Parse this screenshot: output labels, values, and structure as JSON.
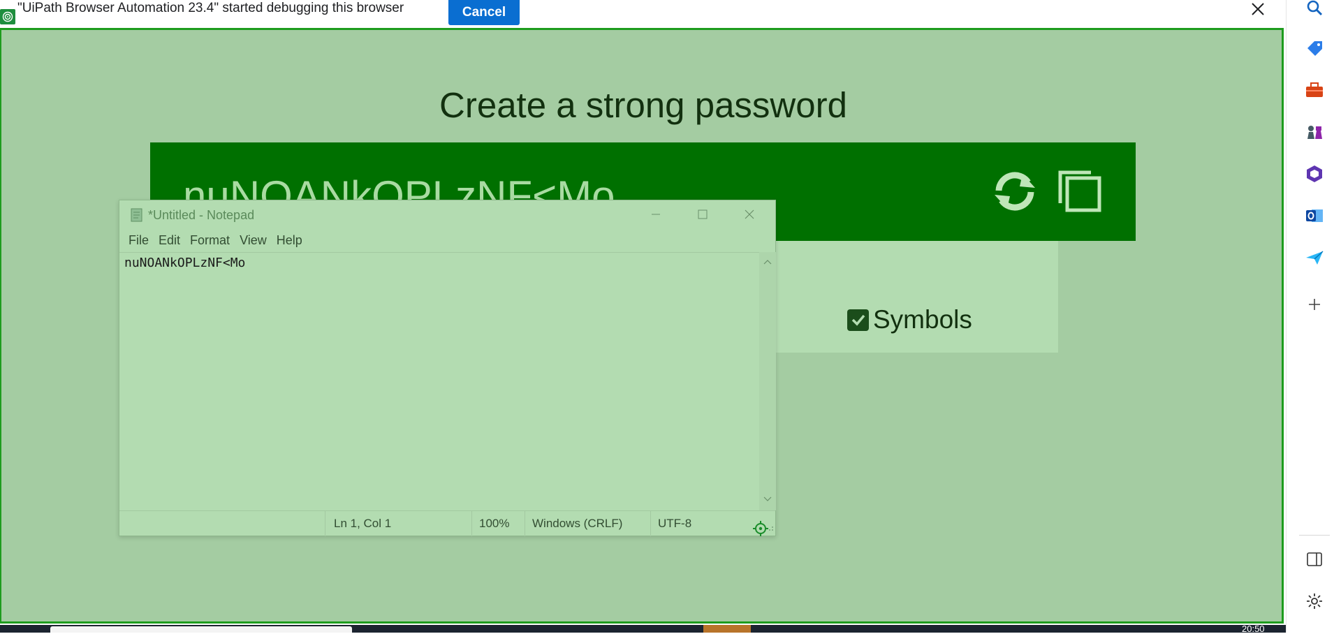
{
  "infobar": {
    "message": "\"UiPath Browser Automation 23.4\" started debugging this browser",
    "cancel_label": "Cancel"
  },
  "page": {
    "heading": "Create a strong password",
    "password": "nuNOANkOPLzNF<Mo",
    "options": {
      "symbols_label": "Symbols",
      "symbols_checked": true
    }
  },
  "notepad": {
    "title": "*Untitled - Notepad",
    "menu": [
      "File",
      "Edit",
      "Format",
      "View",
      "Help"
    ],
    "content": "nuNOANkOPLzNF<Mo",
    "status": {
      "position": "Ln 1, Col 1",
      "zoom": "100%",
      "line_endings": "Windows (CRLF)",
      "encoding": "UTF-8"
    }
  },
  "sidebar": {
    "icons": [
      "search-icon",
      "tag-icon",
      "briefcase-icon",
      "chess-icon",
      "office-icon",
      "outlook-icon",
      "send-icon",
      "add-icon",
      "sidebar-toggle-icon",
      "settings-icon"
    ]
  },
  "taskbar": {
    "clock": "20:50"
  },
  "colors": {
    "accent_green": "#007000",
    "page_bg": "#a4cca2",
    "cancel_blue": "#0a6ed1"
  }
}
